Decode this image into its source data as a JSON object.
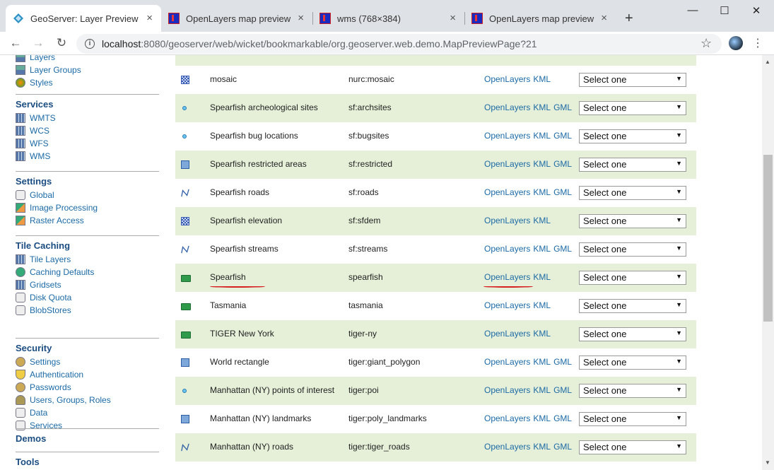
{
  "browser": {
    "tabs": [
      {
        "title": "GeoServer: Layer Preview",
        "close": "×"
      },
      {
        "title": "OpenLayers map preview",
        "close": "×"
      },
      {
        "title": "wms (768×384)",
        "close": "×"
      },
      {
        "title": "OpenLayers map preview",
        "close": "×"
      }
    ],
    "new_tab": "+",
    "window": {
      "minimize": "—",
      "maximize": "☐",
      "close": "✕"
    },
    "nav": {
      "back": "←",
      "forward": "→",
      "reload": "↻"
    },
    "url_host": "localhost",
    "url_rest": ":8080/geoserver/web/wicket/bookmarkable/org.geoserver.web.demo.MapPreviewPage?21",
    "info": "i",
    "star": "☆",
    "menu": "⋮"
  },
  "sidebar": {
    "top_items": [
      {
        "label": "Layers",
        "icon": "layers-icon"
      },
      {
        "label": "Layer Groups",
        "icon": "layer-groups-icon"
      },
      {
        "label": "Styles",
        "icon": "palette-icon"
      }
    ],
    "sections": [
      {
        "heading": "Services",
        "items": [
          {
            "label": "WMTS",
            "icon": "service-icon"
          },
          {
            "label": "WCS",
            "icon": "service-icon"
          },
          {
            "label": "WFS",
            "icon": "service-icon"
          },
          {
            "label": "WMS",
            "icon": "service-icon"
          }
        ]
      },
      {
        "heading": "Settings",
        "items": [
          {
            "label": "Global",
            "icon": "server-icon"
          },
          {
            "label": "Image Processing",
            "icon": "image-icon"
          },
          {
            "label": "Raster Access",
            "icon": "image-icon"
          }
        ]
      },
      {
        "heading": "Tile Caching",
        "items": [
          {
            "label": "Tile Layers",
            "icon": "grid-icon"
          },
          {
            "label": "Caching Defaults",
            "icon": "globe-icon"
          },
          {
            "label": "Gridsets",
            "icon": "grid-icon"
          },
          {
            "label": "Disk Quota",
            "icon": "disk-icon"
          },
          {
            "label": "BlobStores",
            "icon": "disk-icon"
          }
        ]
      },
      {
        "heading": "Security",
        "items": [
          {
            "label": "Settings",
            "icon": "key-icon"
          },
          {
            "label": "Authentication",
            "icon": "shield-icon"
          },
          {
            "label": "Passwords",
            "icon": "key-icon"
          },
          {
            "label": "Users, Groups, Roles",
            "icon": "user-icon"
          },
          {
            "label": "Data",
            "icon": "data-icon"
          },
          {
            "label": "Services",
            "icon": "data-icon"
          }
        ]
      },
      {
        "heading": "Demos",
        "items": []
      },
      {
        "heading": "Tools",
        "items": []
      }
    ]
  },
  "layers": [
    {
      "type": "raster",
      "title": "mosaic",
      "name": "nurc:mosaic",
      "links": [
        "OpenLayers",
        "KML"
      ],
      "select": "Select one"
    },
    {
      "type": "point",
      "title": "Spearfish archeological sites",
      "name": "sf:archsites",
      "links": [
        "OpenLayers",
        "KML",
        "GML"
      ],
      "select": "Select one"
    },
    {
      "type": "point",
      "title": "Spearfish bug locations",
      "name": "sf:bugsites",
      "links": [
        "OpenLayers",
        "KML",
        "GML"
      ],
      "select": "Select one"
    },
    {
      "type": "polygon",
      "title": "Spearfish restricted areas",
      "name": "sf:restricted",
      "links": [
        "OpenLayers",
        "KML",
        "GML"
      ],
      "select": "Select one"
    },
    {
      "type": "line",
      "title": "Spearfish roads",
      "name": "sf:roads",
      "links": [
        "OpenLayers",
        "KML",
        "GML"
      ],
      "select": "Select one"
    },
    {
      "type": "raster",
      "title": "Spearfish elevation",
      "name": "sf:sfdem",
      "links": [
        "OpenLayers",
        "KML"
      ],
      "select": "Select one"
    },
    {
      "type": "line",
      "title": "Spearfish streams",
      "name": "sf:streams",
      "links": [
        "OpenLayers",
        "KML",
        "GML"
      ],
      "select": "Select one"
    },
    {
      "type": "group",
      "title": "Spearfish",
      "name": "spearfish",
      "links": [
        "OpenLayers",
        "KML"
      ],
      "select": "Select one"
    },
    {
      "type": "group",
      "title": "Tasmania",
      "name": "tasmania",
      "links": [
        "OpenLayers",
        "KML"
      ],
      "select": "Select one"
    },
    {
      "type": "group",
      "title": "TIGER New York",
      "name": "tiger-ny",
      "links": [
        "OpenLayers",
        "KML"
      ],
      "select": "Select one"
    },
    {
      "type": "polygon",
      "title": "World rectangle",
      "name": "tiger:giant_polygon",
      "links": [
        "OpenLayers",
        "KML",
        "GML"
      ],
      "select": "Select one"
    },
    {
      "type": "point",
      "title": "Manhattan (NY) points of interest",
      "name": "tiger:poi",
      "links": [
        "OpenLayers",
        "KML",
        "GML"
      ],
      "select": "Select one"
    },
    {
      "type": "polygon",
      "title": "Manhattan (NY) landmarks",
      "name": "tiger:poly_landmarks",
      "links": [
        "OpenLayers",
        "KML",
        "GML"
      ],
      "select": "Select one"
    },
    {
      "type": "line",
      "title": "Manhattan (NY) roads",
      "name": "tiger:tiger_roads",
      "links": [
        "OpenLayers",
        "KML",
        "GML"
      ],
      "select": "Select one"
    }
  ],
  "annotation_color": "#d61f1f",
  "row_alt_color": "#e6f0d8"
}
